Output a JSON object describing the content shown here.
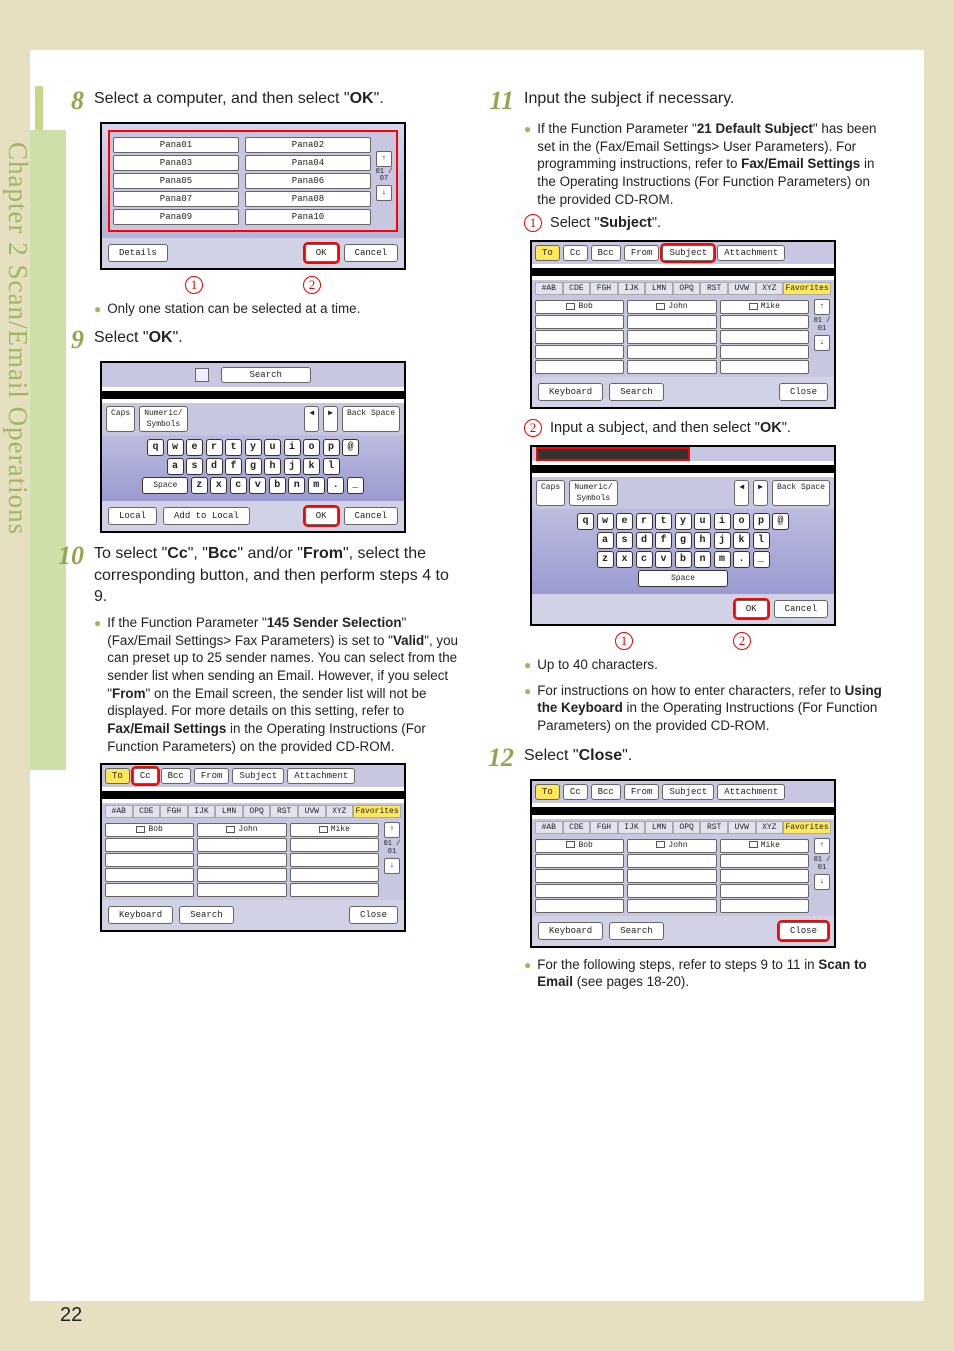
{
  "sidebar": {
    "chapter": "Chapter 2    Scan/Email Operations"
  },
  "page_number": "22",
  "step8": {
    "num": "8",
    "text_a": "Select a computer, and then select \"",
    "text_b": "OK",
    "text_c": "\".",
    "computers": [
      "Pana01",
      "Pana02",
      "Pana03",
      "Pana04",
      "Pana05",
      "Pana06",
      "Pana07",
      "Pana08",
      "Pana09",
      "Pana10"
    ],
    "counter": "01 / 07",
    "details": "Details",
    "ok": "OK",
    "cancel": "Cancel",
    "note": "Only one station can be selected at a time."
  },
  "step9": {
    "num": "9",
    "text_a": "Select \"",
    "text_b": "OK",
    "text_c": "\".",
    "search_label": "Search",
    "caps": "Caps",
    "numeric": "Numeric/\nSymbols",
    "backspace": "Back Space",
    "space": "Space",
    "local": "Local",
    "add_local": "Add to Local",
    "ok": "OK",
    "cancel": "Cancel",
    "row1": [
      "q",
      "w",
      "e",
      "r",
      "t",
      "y",
      "u",
      "i",
      "o",
      "p",
      "@"
    ],
    "row2": [
      "a",
      "s",
      "d",
      "f",
      "g",
      "h",
      "j",
      "k",
      "l"
    ],
    "row3": [
      "z",
      "x",
      "c",
      "v",
      "b",
      "n",
      "m",
      ".",
      "_"
    ]
  },
  "step10": {
    "num": "10",
    "text_a": "To select \"",
    "cc": "Cc",
    "text_b": "\", \"",
    "bcc": "Bcc",
    "text_c": "\" and/or \"",
    "from": "From",
    "text_d": "\", select the corresponding button, and then perform steps 4 to 9.",
    "bullet_pre": "If the Function Parameter \"",
    "b145": "145 Sender Selection",
    "bullet_mid1": "\" (Fax/Email Settings> Fax Parameters) is set to \"",
    "valid": "Valid",
    "bullet_mid2": "\", you can preset up to 25 sender names. You can select from the sender list when sending an Email. However, if you select \"",
    "from2": "From",
    "bullet_mid3": "\" on the Email screen, the sender list will not be displayed. For more details on this setting, refer to ",
    "faxemail": "Fax/Email Settings",
    "bullet_tail": " in the Operating Instructions (For Function Parameters) on the provided CD-ROM.",
    "tabs": [
      "To",
      "Cc",
      "Bcc",
      "From",
      "Subject",
      "Attachment"
    ],
    "alpha": [
      "#AB",
      "CDE",
      "FGH",
      "IJK",
      "LMN",
      "OPQ",
      "RST",
      "UVW",
      "XYZ"
    ],
    "fav": "Favorites",
    "names": [
      "Bob",
      "John",
      "Mike"
    ],
    "counter": "01 / 01",
    "keyboard": "Keyboard",
    "search": "Search",
    "close": "Close"
  },
  "step11": {
    "num": "11",
    "text": "Input the subject if necessary.",
    "b1_pre": "If the Function Parameter \"",
    "b21": "21 Default Subject",
    "b1_mid": "\" has been set in the (Fax/Email Settings> User Parameters). For programming instructions, refer to ",
    "faxemail": "Fax/Email Settings",
    "b1_tail": " in the Operating Instructions (For Function Parameters) on the provided CD-ROM.",
    "line1_pre": "Select \"",
    "subject": "Subject",
    "line1_post": "\".",
    "line2_pre": "Input a subject, and then select \"",
    "ok2": "OK",
    "line2_post": "\".",
    "caps": "Caps",
    "numeric": "Numeric/\nSymbols",
    "backspace": "Back Space",
    "space": "Space",
    "ok": "OK",
    "cancel": "Cancel",
    "row1": [
      "q",
      "w",
      "e",
      "r",
      "t",
      "y",
      "u",
      "i",
      "o",
      "p",
      "@"
    ],
    "row2": [
      "a",
      "s",
      "d",
      "f",
      "g",
      "h",
      "j",
      "k",
      "l"
    ],
    "row3": [
      "z",
      "x",
      "c",
      "v",
      "b",
      "n",
      "m",
      ".",
      "_"
    ],
    "up40": "Up to 40 characters.",
    "instr_pre": "For instructions on how to enter characters, refer to ",
    "using_kbd": "Using the Keyboard",
    "instr_post": " in the Operating Instructions (For Function Parameters) on the provided CD-ROM.",
    "tabs": [
      "To",
      "Cc",
      "Bcc",
      "From",
      "Subject",
      "Attachment"
    ],
    "alpha": [
      "#AB",
      "CDE",
      "FGH",
      "IJK",
      "LMN",
      "OPQ",
      "RST",
      "UVW",
      "XYZ"
    ],
    "fav": "Favorites",
    "names": [
      "Bob",
      "John",
      "Mike"
    ],
    "counter": "01 / 01",
    "keyboard": "Keyboard",
    "search": "Search",
    "close": "Close"
  },
  "step12": {
    "num": "12",
    "text_a": "Select \"",
    "close_b": "Close",
    "text_b": "\".",
    "bullet_pre": "For the following steps, refer to steps 9 to 11 in ",
    "scan_email": "Scan to Email",
    "bullet_post": " (see pages 18-20)."
  },
  "ui": {
    "arrow_left": "◀",
    "arrow_right": "▶",
    "arrow_up": "↑",
    "arrow_down": "↓"
  }
}
